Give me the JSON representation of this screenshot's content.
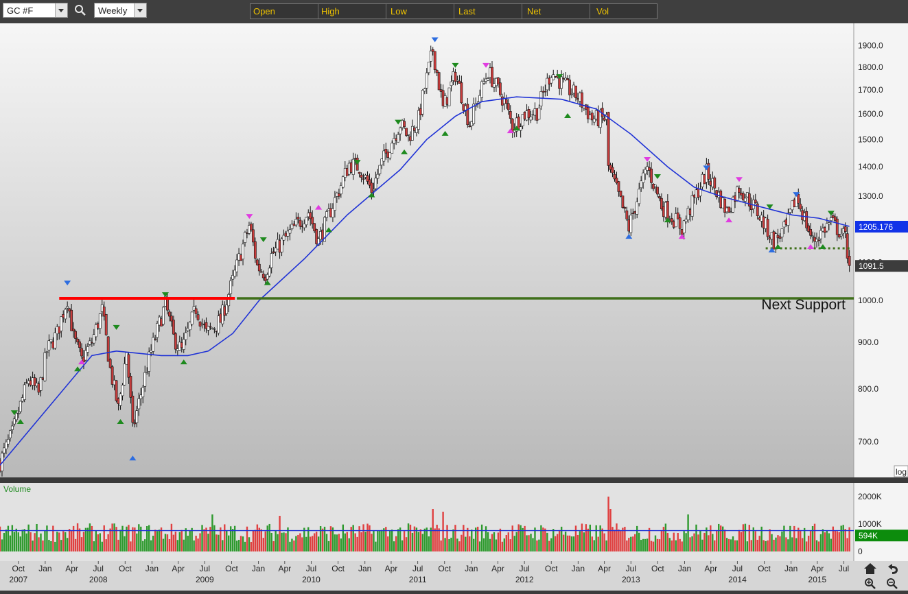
{
  "toolbar": {
    "symbol": "GC #F",
    "period": "Weekly",
    "columns": [
      "Open",
      "High",
      "Low",
      "Last",
      "Net",
      "Vol"
    ]
  },
  "price_panel": {
    "scale_mode": "log",
    "annotation": "Next Support",
    "last_price_label": "1091.5",
    "ma_value_label": "1205.176",
    "ma_color": "#1f32d6",
    "up_color": "#ffffff",
    "down_color": "#c83c3c",
    "resistance_color": "#ff0000",
    "support_color": "#3f6f1a"
  },
  "volume_panel": {
    "title": "Volume",
    "current_label": "594K",
    "ticks": [
      "2000K",
      "1000K",
      "0"
    ]
  },
  "chart_data": [
    {
      "type": "candlestick",
      "title": "",
      "frequency": "weekly",
      "yscale": "log",
      "ylim": [
        640,
        2010
      ],
      "y_ticks": [
        "700.0",
        "800.0",
        "900.0",
        "1000.0",
        "1100.0",
        "1200.0",
        "1300.0",
        "1400.0",
        "1500.0",
        "1600.0",
        "1700.0",
        "1800.0",
        "1900.0"
      ],
      "x_tick_labels": [
        "Oct",
        "Jan",
        "Apr",
        "Jul",
        "Oct",
        "Jan",
        "Apr",
        "Jul",
        "Oct",
        "Jan",
        "Apr",
        "Jul",
        "Oct",
        "Jan",
        "Apr",
        "Jul",
        "Oct",
        "Jan",
        "Apr",
        "Jul",
        "Oct",
        "Jan",
        "Apr",
        "Jul",
        "Oct",
        "Jan",
        "Apr",
        "Jul",
        "Oct",
        "Jan",
        "Apr",
        "Jul"
      ],
      "x_year_labels": [
        "2007",
        "2008",
        "2009",
        "2010",
        "2011",
        "2012",
        "2013",
        "2014",
        "2015"
      ],
      "x_ticks": [
        "2007-10-01",
        "2008-01-01",
        "2008-04-01",
        "2008-07-01",
        "2008-10-01",
        "2009-01-01",
        "2009-04-01",
        "2009-07-01",
        "2009-10-01",
        "2010-01-01",
        "2010-04-01",
        "2010-07-01",
        "2010-10-01",
        "2011-01-01",
        "2011-04-01",
        "2011-07-01",
        "2011-10-01",
        "2012-01-01",
        "2012-04-01",
        "2012-07-01",
        "2012-10-01",
        "2013-01-01",
        "2013-04-01",
        "2013-07-01",
        "2013-10-01",
        "2014-01-01",
        "2014-04-01",
        "2014-07-01",
        "2014-10-01",
        "2015-01-01",
        "2015-04-01",
        "2015-07-01"
      ],
      "year_positions": [
        "2007-10-01",
        "2008-07-01",
        "2009-07-01",
        "2010-07-01",
        "2011-07-01",
        "2012-07-01",
        "2013-07-01",
        "2014-07-01",
        "2015-04-01"
      ],
      "xlim": [
        "2007-07-30",
        "2015-08-04"
      ],
      "price_path": [
        {
          "date": "2007-07-30",
          "price": 665
        },
        {
          "date": "2007-09-10",
          "price": 715
        },
        {
          "date": "2007-11-05",
          "price": 820
        },
        {
          "date": "2007-12-10",
          "price": 790
        },
        {
          "date": "2008-01-07",
          "price": 880
        },
        {
          "date": "2008-02-11",
          "price": 920
        },
        {
          "date": "2008-03-17",
          "price": 1005
        },
        {
          "date": "2008-04-07",
          "price": 910
        },
        {
          "date": "2008-05-05",
          "price": 860
        },
        {
          "date": "2008-06-09",
          "price": 900
        },
        {
          "date": "2008-07-14",
          "price": 975
        },
        {
          "date": "2008-08-11",
          "price": 840
        },
        {
          "date": "2008-09-08",
          "price": 760
        },
        {
          "date": "2008-10-06",
          "price": 880
        },
        {
          "date": "2008-10-27",
          "price": 720
        },
        {
          "date": "2008-11-24",
          "price": 790
        },
        {
          "date": "2008-12-29",
          "price": 880
        },
        {
          "date": "2009-02-16",
          "price": 990
        },
        {
          "date": "2009-03-16",
          "price": 910
        },
        {
          "date": "2009-04-13",
          "price": 880
        },
        {
          "date": "2009-06-01",
          "price": 980
        },
        {
          "date": "2009-07-06",
          "price": 920
        },
        {
          "date": "2009-08-24",
          "price": 950
        },
        {
          "date": "2009-10-05",
          "price": 1050
        },
        {
          "date": "2009-12-01",
          "price": 1210
        },
        {
          "date": "2009-12-28",
          "price": 1090
        },
        {
          "date": "2010-01-25",
          "price": 1070
        },
        {
          "date": "2010-02-15",
          "price": 1120
        },
        {
          "date": "2010-05-03",
          "price": 1200
        },
        {
          "date": "2010-06-21",
          "price": 1250
        },
        {
          "date": "2010-07-26",
          "price": 1160
        },
        {
          "date": "2010-10-04",
          "price": 1320
        },
        {
          "date": "2010-11-08",
          "price": 1410
        },
        {
          "date": "2010-12-13",
          "price": 1400
        },
        {
          "date": "2011-01-24",
          "price": 1320
        },
        {
          "date": "2011-03-07",
          "price": 1430
        },
        {
          "date": "2011-05-02",
          "price": 1560
        },
        {
          "date": "2011-05-30",
          "price": 1510
        },
        {
          "date": "2011-07-04",
          "price": 1580
        },
        {
          "date": "2011-08-22",
          "price": 1880
        },
        {
          "date": "2011-09-26",
          "price": 1620
        },
        {
          "date": "2011-11-07",
          "price": 1770
        },
        {
          "date": "2011-12-26",
          "price": 1560
        },
        {
          "date": "2012-02-27",
          "price": 1780
        },
        {
          "date": "2012-04-23",
          "price": 1650
        },
        {
          "date": "2012-05-21",
          "price": 1550
        },
        {
          "date": "2012-07-02",
          "price": 1600
        },
        {
          "date": "2012-08-13",
          "price": 1610
        },
        {
          "date": "2012-10-01",
          "price": 1780
        },
        {
          "date": "2012-11-12",
          "price": 1720
        },
        {
          "date": "2012-12-31",
          "price": 1670
        },
        {
          "date": "2013-02-18",
          "price": 1580
        },
        {
          "date": "2013-04-08",
          "price": 1580
        },
        {
          "date": "2013-04-15",
          "price": 1400
        },
        {
          "date": "2013-06-24",
          "price": 1200
        },
        {
          "date": "2013-08-26",
          "price": 1400
        },
        {
          "date": "2013-10-14",
          "price": 1270
        },
        {
          "date": "2013-12-23",
          "price": 1200
        },
        {
          "date": "2014-03-17",
          "price": 1380
        },
        {
          "date": "2014-05-26",
          "price": 1250
        },
        {
          "date": "2014-07-07",
          "price": 1330
        },
        {
          "date": "2014-09-01",
          "price": 1260
        },
        {
          "date": "2014-11-03",
          "price": 1160
        },
        {
          "date": "2014-12-15",
          "price": 1200
        },
        {
          "date": "2015-01-19",
          "price": 1300
        },
        {
          "date": "2015-03-16",
          "price": 1160
        },
        {
          "date": "2015-05-18",
          "price": 1220
        },
        {
          "date": "2015-07-06",
          "price": 1170
        },
        {
          "date": "2015-07-20",
          "price": 1091.5
        }
      ],
      "moving_average": {
        "value_label": "1205.176",
        "path": [
          {
            "date": "2007-07-30",
            "price": 660
          },
          {
            "date": "2008-06-09",
            "price": 870
          },
          {
            "date": "2008-09-01",
            "price": 880
          },
          {
            "date": "2009-02-02",
            "price": 870
          },
          {
            "date": "2009-05-04",
            "price": 870
          },
          {
            "date": "2009-07-13",
            "price": 880
          },
          {
            "date": "2009-10-05",
            "price": 920
          },
          {
            "date": "2010-01-04",
            "price": 1000
          },
          {
            "date": "2010-06-07",
            "price": 1110
          },
          {
            "date": "2010-11-01",
            "price": 1240
          },
          {
            "date": "2011-05-02",
            "price": 1390
          },
          {
            "date": "2011-08-01",
            "price": 1500
          },
          {
            "date": "2011-11-07",
            "price": 1590
          },
          {
            "date": "2012-02-06",
            "price": 1650
          },
          {
            "date": "2012-06-04",
            "price": 1670
          },
          {
            "date": "2012-11-05",
            "price": 1660
          },
          {
            "date": "2013-03-04",
            "price": 1620
          },
          {
            "date": "2013-07-01",
            "price": 1520
          },
          {
            "date": "2013-11-04",
            "price": 1400
          },
          {
            "date": "2014-02-03",
            "price": 1330
          },
          {
            "date": "2014-05-05",
            "price": 1300
          },
          {
            "date": "2014-09-01",
            "price": 1270
          },
          {
            "date": "2015-01-05",
            "price": 1240
          },
          {
            "date": "2015-04-06",
            "price": 1230
          },
          {
            "date": "2015-07-20",
            "price": 1205
          }
        ]
      },
      "lines": [
        {
          "name": "resistance",
          "style": "solid",
          "color": "#ff0000",
          "price": 1005,
          "from": "2008-02-18",
          "to": "2009-10-12"
        },
        {
          "name": "support",
          "style": "solid",
          "color": "#3f6f1a",
          "price": 1005,
          "from": "2009-10-19",
          "to": "2015-08-04"
        },
        {
          "name": "neckline",
          "style": "dotted",
          "color": "#3f6f1a",
          "price": 1140,
          "from": "2014-10-06",
          "to": "2015-07-27"
        }
      ],
      "pivots": [
        {
          "date": "2008-03-17",
          "price": 1040,
          "color": "blue",
          "dir": "down"
        },
        {
          "date": "2008-10-27",
          "price": 675,
          "color": "blue",
          "dir": "up"
        },
        {
          "date": "2011-08-29",
          "price": 1920,
          "color": "blue",
          "dir": "down"
        },
        {
          "date": "2013-06-24",
          "price": 1180,
          "color": "blue",
          "dir": "up"
        },
        {
          "date": "2014-03-17",
          "price": 1390,
          "color": "blue",
          "dir": "down"
        },
        {
          "date": "2014-10-27",
          "price": 1140,
          "color": "blue",
          "dir": "up"
        },
        {
          "date": "2015-01-19",
          "price": 1300,
          "color": "blue",
          "dir": "down"
        },
        {
          "date": "2009-12-01",
          "price": 1230,
          "color": "magenta",
          "dir": "down"
        },
        {
          "date": "2012-02-20",
          "price": 1800,
          "color": "magenta",
          "dir": "down"
        },
        {
          "date": "2013-08-26",
          "price": 1420,
          "color": "magenta",
          "dir": "down"
        },
        {
          "date": "2014-07-07",
          "price": 1350,
          "color": "magenta",
          "dir": "down"
        },
        {
          "date": "2008-05-05",
          "price": 860,
          "color": "magenta",
          "dir": "up"
        },
        {
          "date": "2010-07-26",
          "price": 1270,
          "color": "magenta",
          "dir": "up"
        },
        {
          "date": "2012-05-14",
          "price": 1540,
          "color": "magenta",
          "dir": "up"
        },
        {
          "date": "2013-12-23",
          "price": 1180,
          "color": "magenta",
          "dir": "up"
        },
        {
          "date": "2014-06-02",
          "price": 1230,
          "color": "magenta",
          "dir": "up"
        },
        {
          "date": "2015-03-09",
          "price": 1150,
          "color": "magenta",
          "dir": "up"
        },
        {
          "date": "2007-09-17",
          "price": 750,
          "color": "green",
          "dir": "down"
        },
        {
          "date": "2008-09-01",
          "price": 930,
          "color": "green",
          "dir": "down"
        },
        {
          "date": "2009-02-16",
          "price": 1010,
          "color": "green",
          "dir": "down"
        },
        {
          "date": "2010-01-18",
          "price": 1160,
          "color": "green",
          "dir": "down"
        },
        {
          "date": "2010-12-06",
          "price": 1410,
          "color": "green",
          "dir": "down"
        },
        {
          "date": "2011-04-25",
          "price": 1560,
          "color": "green",
          "dir": "down"
        },
        {
          "date": "2011-11-07",
          "price": 1800,
          "color": "green",
          "dir": "down"
        },
        {
          "date": "2012-10-29",
          "price": 1750,
          "color": "green",
          "dir": "down"
        },
        {
          "date": "2013-09-30",
          "price": 1360,
          "color": "green",
          "dir": "down"
        },
        {
          "date": "2014-10-20",
          "price": 1260,
          "color": "green",
          "dir": "down"
        },
        {
          "date": "2015-05-18",
          "price": 1240,
          "color": "green",
          "dir": "down"
        },
        {
          "date": "2007-10-08",
          "price": 740,
          "color": "green",
          "dir": "up"
        },
        {
          "date": "2008-04-21",
          "price": 845,
          "color": "green",
          "dir": "up"
        },
        {
          "date": "2008-09-15",
          "price": 740,
          "color": "green",
          "dir": "up"
        },
        {
          "date": "2009-04-20",
          "price": 860,
          "color": "green",
          "dir": "up"
        },
        {
          "date": "2010-02-01",
          "price": 1050,
          "color": "green",
          "dir": "up"
        },
        {
          "date": "2010-08-30",
          "price": 1200,
          "color": "green",
          "dir": "up"
        },
        {
          "date": "2011-01-24",
          "price": 1310,
          "color": "green",
          "dir": "up"
        },
        {
          "date": "2011-05-16",
          "price": 1460,
          "color": "green",
          "dir": "up"
        },
        {
          "date": "2011-10-03",
          "price": 1530,
          "color": "green",
          "dir": "up"
        },
        {
          "date": "2012-06-04",
          "price": 1550,
          "color": "green",
          "dir": "up"
        },
        {
          "date": "2012-11-26",
          "price": 1600,
          "color": "green",
          "dir": "up"
        },
        {
          "date": "2013-11-04",
          "price": 1230,
          "color": "green",
          "dir": "up"
        },
        {
          "date": "2014-11-17",
          "price": 1150,
          "color": "green",
          "dir": "up"
        },
        {
          "date": "2015-04-20",
          "price": 1150,
          "color": "green",
          "dir": "up"
        }
      ]
    },
    {
      "type": "bar",
      "title": "Volume",
      "ylim": [
        0,
        2400
      ],
      "y_unit": "K",
      "average_level": 760,
      "current_value_label": "594K",
      "typical_range": [
        350,
        1200
      ],
      "spikes": [
        {
          "date": "2009-07-27",
          "value": 1350
        },
        {
          "date": "2010-03-15",
          "value": 1300
        },
        {
          "date": "2011-08-22",
          "value": 1550
        },
        {
          "date": "2011-09-26",
          "value": 1450
        },
        {
          "date": "2013-04-15",
          "value": 2000
        },
        {
          "date": "2013-04-22",
          "value": 1550
        },
        {
          "date": "2014-01-13",
          "value": 1350
        }
      ]
    }
  ]
}
